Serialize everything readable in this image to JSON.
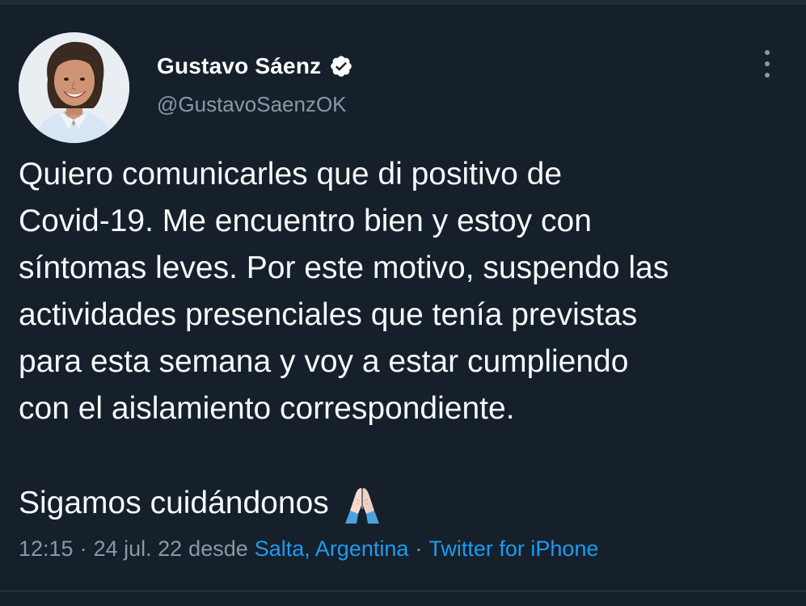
{
  "author": {
    "display_name": "Gustavo Sáenz",
    "handle": "@GustavoSaenzOK",
    "verified_icon": "verified-badge-icon",
    "avatar_icon": "profile-photo"
  },
  "tweet": {
    "lines": [
      "Quiero comunicarles que di positivo de",
      "Covid-19. Me encuentro bien y estoy con",
      "síntomas leves. Por este motivo, suspendo las",
      "actividades presenciales que tenía previstas",
      "para esta semana y voy a estar cumpliendo",
      "con el aislamiento correspondiente."
    ],
    "closing": "Sigamos cuidándonos",
    "closing_emoji": "folded-hands-icon"
  },
  "meta": {
    "time": "12:15",
    "date": "24 jul. 22",
    "desde": "desde",
    "location": "Salta, Argentina",
    "source": "Twitter for iPhone"
  },
  "menu": {
    "icon": "more-options-icon"
  },
  "colors": {
    "background": "#15202b",
    "text": "#f7f9f9",
    "secondary": "#8b98a5",
    "link": "#1d9bf0",
    "verified": "#ffffff"
  }
}
